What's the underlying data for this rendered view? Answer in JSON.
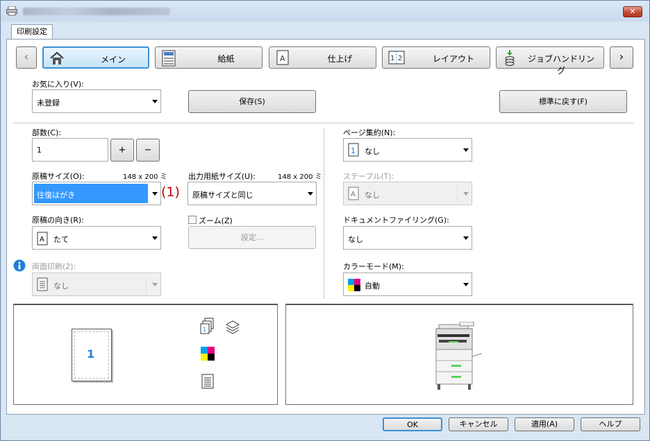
{
  "window": {
    "close_label": "✕"
  },
  "tab": {
    "label": "印刷設定"
  },
  "nav": {
    "prev": "‹",
    "next": "›",
    "items": [
      {
        "label": "メイン",
        "icon": "home-icon"
      },
      {
        "label": "給紙",
        "icon": "paper-tray-icon"
      },
      {
        "label": "仕上げ",
        "icon": "finishing-icon"
      },
      {
        "label": "レイアウト",
        "icon": "layout-icon"
      },
      {
        "label": "ジョブハンドリング",
        "icon": "job-handling-icon"
      }
    ]
  },
  "favorites": {
    "label": "お気に入り(V):",
    "value": "未登録",
    "save": "保存(S)",
    "reset": "標準に戻す(F)"
  },
  "copies": {
    "label": "部数(C):",
    "value": "1",
    "plus": "+",
    "minus": "−"
  },
  "original_size": {
    "label": "原稿サイズ(O):",
    "dim": "148 x 200 ミ",
    "value": "往復はがき",
    "callout": "(1)"
  },
  "output_size": {
    "label": "出力用紙サイズ(U):",
    "dim": "148 x 200 ミ",
    "value": "原稿サイズと同じ"
  },
  "orientation": {
    "label": "原稿の向き(R):",
    "value": "たて"
  },
  "zoom": {
    "label": "ズーム(Z)",
    "settings": "設定..."
  },
  "duplex": {
    "label": "両面印刷(2):",
    "value": "なし"
  },
  "nup": {
    "label": "ページ集約(N):",
    "value": "なし"
  },
  "staple": {
    "label": "ステープル(T):",
    "value": "なし"
  },
  "filing": {
    "label": "ドキュメントファイリング(G):",
    "value": "なし"
  },
  "color": {
    "label": "カラーモード(M):",
    "value": "自動"
  },
  "preview": {
    "page_number": "1"
  },
  "footer": {
    "ok": "OK",
    "cancel": "キャンセル",
    "apply": "適用(A)",
    "help": "ヘルプ"
  },
  "colors": {
    "accent": "#3c8fd4",
    "selected_bg": "#3399ff",
    "callout": "#c00000",
    "info": "#1e7fd6"
  }
}
